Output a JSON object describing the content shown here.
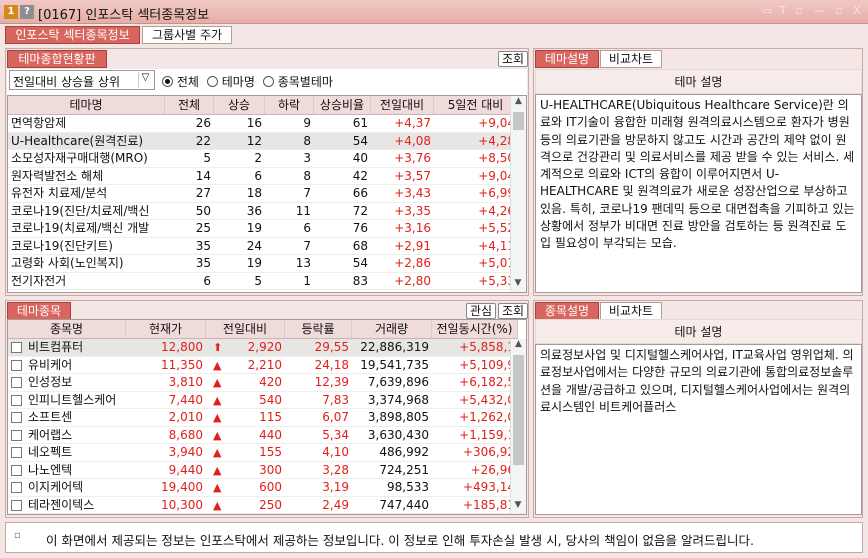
{
  "window": {
    "number_badge": "1",
    "help_badge": "?",
    "title": "[0167] 인포스탁 섹터종목정보",
    "btn_min": "▭",
    "btn_max": "T",
    "btn_restore": "▫",
    "btn_close": "X",
    "btn_dash": "—"
  },
  "tabs": [
    {
      "label": "인포스탁 섹터종목정보"
    },
    {
      "label": "그룹사별 주가"
    }
  ],
  "theme_panel": {
    "tab_label": "테마종합현황판",
    "query_button": "조회",
    "sort_select": "전일대비 상승율 상위",
    "sort_arrow": "▽",
    "radios": [
      {
        "label": "전체",
        "checked": true
      },
      {
        "label": "테마명",
        "checked": false
      },
      {
        "label": "종목별테마",
        "checked": false
      }
    ],
    "columns": [
      "테마명",
      "전체",
      "상승",
      "하락",
      "상승비율",
      "전일대비",
      "5일전 대비"
    ],
    "rows": [
      [
        "면역항암제",
        "26",
        "16",
        "9",
        "61",
        "+4,37",
        "+9,04"
      ],
      [
        "U-Healthcare(원격진료)",
        "22",
        "12",
        "8",
        "54",
        "+4,08",
        "+4,28"
      ],
      [
        "소모성자재구매대행(MRO)",
        "5",
        "2",
        "3",
        "40",
        "+3,76",
        "+8,50"
      ],
      [
        "원자력발전소 해체",
        "14",
        "6",
        "8",
        "42",
        "+3,57",
        "+9,04"
      ],
      [
        "유전자 치료제/분석",
        "27",
        "18",
        "7",
        "66",
        "+3,43",
        "+6,99"
      ],
      [
        "코로나19(진단/치료제/백신",
        "50",
        "36",
        "11",
        "72",
        "+3,35",
        "+4,26"
      ],
      [
        "코로나19(치료제/백신 개발",
        "25",
        "19",
        "6",
        "76",
        "+3,16",
        "+5,52"
      ],
      [
        "코로나19(진단키트)",
        "35",
        "24",
        "7",
        "68",
        "+2,91",
        "+4,11"
      ],
      [
        "고령화 사회(노인복지)",
        "35",
        "19",
        "13",
        "54",
        "+2,86",
        "+5,01"
      ],
      [
        "전기자전거",
        "6",
        "5",
        "1",
        "83",
        "+2,80",
        "+5,33"
      ]
    ],
    "selected_row": 1
  },
  "theme_desc_panel": {
    "tabs": [
      {
        "label": "테마설명"
      },
      {
        "label": "비교차트"
      }
    ],
    "header": "테마 설명",
    "text": "U-HEALTHCARE(Ubiquitous Healthcare Service)란 의료와 IT기술이 융합한 미래형 원격의료시스템으로 환자가 병원 등의 의료기관을 방문하지 않고도 시간과 공간의 제약 없이 원격으로 건강관리 및 의료서비스를 제공 받을 수 있는 서비스. 세계적으로 의료와 ICT의 융합이 이루어지면서 U-HEALTHCARE 및 원격의료가 새로운 성장산업으로 부상하고 있음. 특히, 코로나19 팬데믹 등으로 대면접촉을 기피하고 있는 상황에서 정부가 비대면 진료 방안을 검토하는 등 원격진료 도입 필요성이 부각되는 모습."
  },
  "stock_panel": {
    "tab_label": "테마종목",
    "interest_button": "관심",
    "query_button": "조회",
    "columns": [
      "종목명",
      "현재가",
      "전일대비",
      "등락률",
      "거래량",
      "전일동시간(%)"
    ],
    "rows": [
      {
        "name": "비트컴퓨터",
        "price": "12,800",
        "arrow": "⬆",
        "change": "2,920",
        "rate": "29,55",
        "volume": "22,886,319",
        "prev": "+5,858,1"
      },
      {
        "name": "유비케어",
        "price": "11,350",
        "arrow": "▲",
        "change": "2,210",
        "rate": "24,18",
        "volume": "19,541,735",
        "prev": "+5,109,9"
      },
      {
        "name": "인성정보",
        "price": "3,810",
        "arrow": "▲",
        "change": "420",
        "rate": "12,39",
        "volume": "7,639,896",
        "prev": "+6,182,5"
      },
      {
        "name": "인피니트헬스케어",
        "price": "7,440",
        "arrow": "▲",
        "change": "540",
        "rate": "7,83",
        "volume": "3,374,968",
        "prev": "+5,432,0"
      },
      {
        "name": "소프트센",
        "price": "2,010",
        "arrow": "▲",
        "change": "115",
        "rate": "6,07",
        "volume": "3,898,805",
        "prev": "+1,262,0"
      },
      {
        "name": "케어랩스",
        "price": "8,680",
        "arrow": "▲",
        "change": "440",
        "rate": "5,34",
        "volume": "3,630,430",
        "prev": "+1,159,1"
      },
      {
        "name": "네오펙트",
        "price": "3,940",
        "arrow": "▲",
        "change": "155",
        "rate": "4,10",
        "volume": "486,992",
        "prev": "+306,92"
      },
      {
        "name": "나노엔텍",
        "price": "9,440",
        "arrow": "▲",
        "change": "300",
        "rate": "3,28",
        "volume": "724,251",
        "prev": "+26,96"
      },
      {
        "name": "이지케어텍",
        "price": "19,400",
        "arrow": "▲",
        "change": "600",
        "rate": "3,19",
        "volume": "98,533",
        "prev": "+493,14"
      },
      {
        "name": "테라젠이텍스",
        "price": "10,300",
        "arrow": "▲",
        "change": "250",
        "rate": "2,49",
        "volume": "747,440",
        "prev": "+185,81"
      }
    ],
    "selected_row": 0
  },
  "stock_desc_panel": {
    "tabs": [
      {
        "label": "종목설명"
      },
      {
        "label": "비교차트"
      }
    ],
    "header": "테마 설명",
    "text": "의료정보사업 및 디지털헬스케어사업, IT교육사업 영위업체. 의료정보사업에서는 다양한 규모의 의료기관에 통합의료정보솔루션을 개발/공급하고 있으며, 디지털헬스케어사업에서는 원격의료시스템인 비트케어플러스"
  },
  "footer": {
    "icon": "▫",
    "text": "이 화면에서 제공되는 정보는 인포스탁에서 제공하는 정보입니다. 이 정보로 인해 투자손실 발생 시, 당사의 책임이 없음을 알려드립니다."
  },
  "colors": {
    "accent": "#d9665e",
    "up": "#e0201a",
    "bg": "#f3e6e4"
  }
}
